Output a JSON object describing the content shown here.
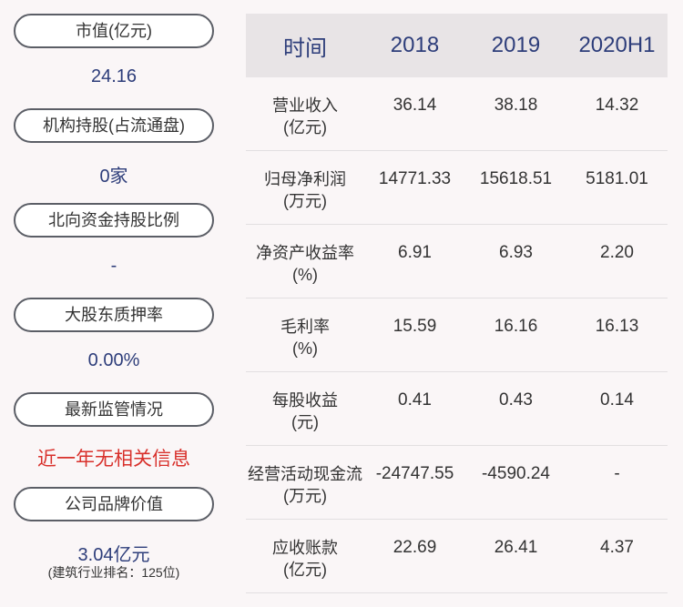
{
  "left": {
    "items": [
      {
        "label": "市值(亿元)",
        "value": "24.16"
      },
      {
        "label": "机构持股(占流通盘)",
        "value": "0家"
      },
      {
        "label": "北向资金持股比例",
        "value": "-"
      },
      {
        "label": "大股东质押率",
        "value": "0.00%"
      },
      {
        "label": "最新监管情况",
        "value": "近一年无相关信息"
      },
      {
        "label": "公司品牌价值",
        "value": "3.04亿元",
        "note": "(建筑行业排名：125位)"
      }
    ]
  },
  "table": {
    "headers": [
      "时间",
      "2018",
      "2019",
      "2020H1"
    ],
    "rows": [
      {
        "label1": "营业收入",
        "label2": "(亿元)",
        "v": [
          "36.14",
          "38.18",
          "14.32"
        ]
      },
      {
        "label1": "归母净利润",
        "label2": "(万元)",
        "v": [
          "14771.33",
          "15618.51",
          "5181.01"
        ]
      },
      {
        "label1": "净资产收益率",
        "label2": "(%)",
        "v": [
          "6.91",
          "6.93",
          "2.20"
        ]
      },
      {
        "label1": "毛利率",
        "label2": "(%)",
        "v": [
          "15.59",
          "16.16",
          "16.13"
        ]
      },
      {
        "label1": "每股收益",
        "label2": "(元)",
        "v": [
          "0.41",
          "0.43",
          "0.14"
        ]
      },
      {
        "label1": "经营活动现金流",
        "label2": "(万元)",
        "v": [
          "-24747.55",
          "-4590.24",
          "-"
        ]
      },
      {
        "label1": "应收账款",
        "label2": "(亿元)",
        "v": [
          "22.69",
          "26.41",
          "4.37"
        ]
      }
    ]
  },
  "colors": {
    "accent": "#2d3d7a",
    "alert": "#d8302b",
    "header_bg": "#e8e4e6"
  }
}
